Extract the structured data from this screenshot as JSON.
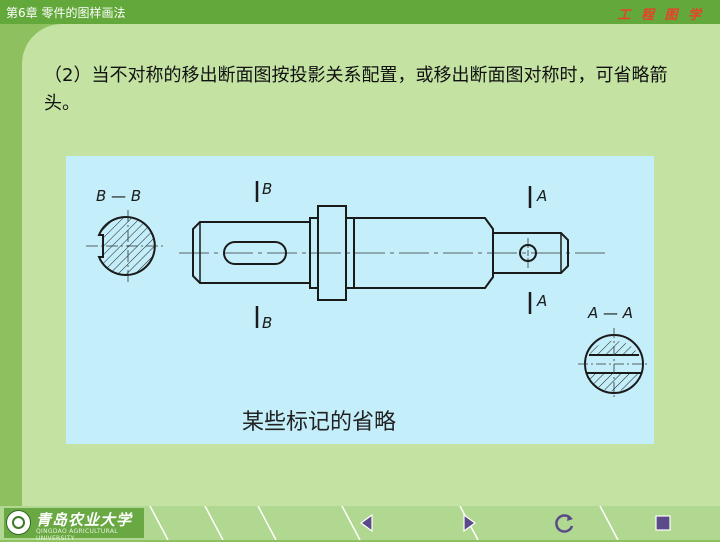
{
  "header": {
    "chapter_title": "第6章  零件的图样画法",
    "course_title": "工 程 图 学"
  },
  "content": {
    "paragraph": "（2）当不对称的移出断面图按投影关系配置，或移出断面图对称时，可省略箭头。"
  },
  "figure": {
    "section_label_bb": "B — B",
    "section_label_aa": "A — A",
    "cut_label_b_top": "B",
    "cut_label_b_bottom": "B",
    "cut_label_a_top": "A",
    "cut_label_a_bottom": "A",
    "caption": "某些标记的省略"
  },
  "footer": {
    "logo_name": "青岛农业大学",
    "logo_sub": "QINGDAO AGRICULTURAL UNIVERSITY",
    "nav": [
      {
        "name": "previous",
        "icon": "triangle-left-icon"
      },
      {
        "name": "next",
        "icon": "triangle-right-icon"
      },
      {
        "name": "return",
        "icon": "circular-arrow-icon"
      },
      {
        "name": "stop",
        "icon": "square-stop-icon"
      }
    ]
  },
  "colors": {
    "background_green": "#8fc060",
    "panel_green": "#c4e3a3",
    "figure_bg": "#c4eefa",
    "title_red": "#e8402a"
  }
}
